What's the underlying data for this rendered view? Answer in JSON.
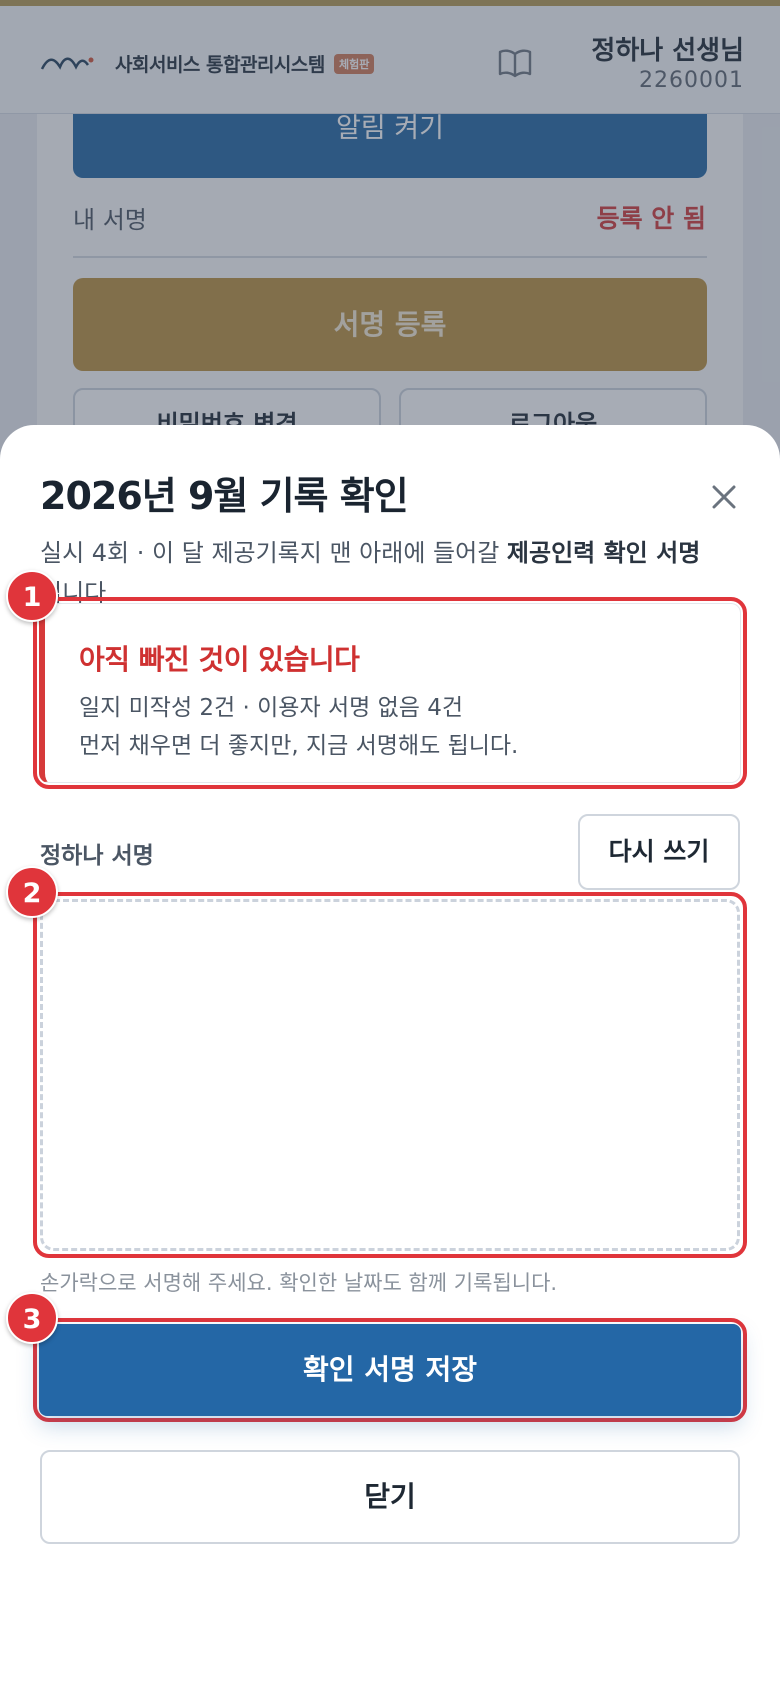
{
  "header": {
    "system_name": "사회서비스 통합관리시스템",
    "edition_badge": "체험판",
    "user_name": "정하나 선생님",
    "user_id": "2260001"
  },
  "background": {
    "notify_button": "알림 켜기",
    "my_signature_label": "내 서명",
    "my_signature_status": "등록 안 됨",
    "register_signature_button": "서명 등록",
    "small_buttons": [
      "비밀번호 변경",
      "로그아웃"
    ]
  },
  "sheet": {
    "title": "2026년 9월 기록 확인",
    "desc_part1": "실시 4회 · 이 달 제공기록지 맨 아래에 들어갈 ",
    "desc_bold": "제공인력 확인 서명",
    "desc_part2": "입니다.",
    "warning": {
      "title": "아직 빠진 것이 있습니다",
      "line1": "일지 미작성 2건 · 이용자 서명 없음 4건",
      "line2": "먼저 채우면 더 좋지만, 지금 서명해도 됩니다."
    },
    "signature_label": "정하나 서명",
    "rewrite_button": "다시 쓰기",
    "hint": "손가락으로 서명해 주세요. 확인한 날짜도 함께 기록됩니다.",
    "save_button": "확인 서명 저장",
    "close_button": "닫기"
  },
  "annotations": [
    "1",
    "2",
    "3"
  ],
  "colors": {
    "accent_blue": "#2467a6",
    "highlight_red": "#e0353b",
    "gold": "#bb913f"
  }
}
